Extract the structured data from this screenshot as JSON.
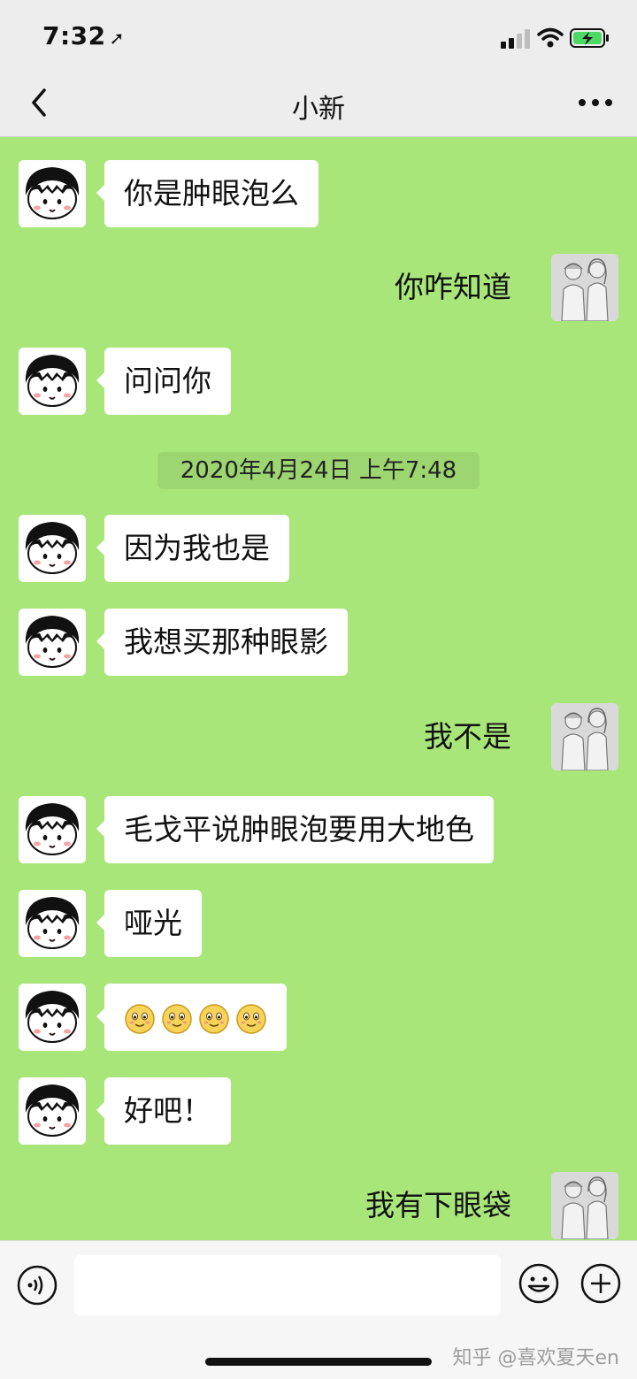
{
  "status_bar": {
    "time": "7:32",
    "battery_color": "#4cd964"
  },
  "header": {
    "title": "小新"
  },
  "messages": [
    {
      "side": "left",
      "text": "你是肿眼泡么"
    },
    {
      "side": "right",
      "text": "你咋知道"
    },
    {
      "side": "left",
      "text": "问问你"
    },
    {
      "type": "timestamp",
      "text": "2020年4月24日 上午7:48"
    },
    {
      "side": "left",
      "text": "因为我也是"
    },
    {
      "side": "left",
      "text": "我想买那种眼影"
    },
    {
      "side": "right",
      "text": "我不是"
    },
    {
      "side": "left",
      "text": "毛戈平说肿眼泡要用大地色"
    },
    {
      "side": "left",
      "text": "哑光"
    },
    {
      "side": "left",
      "emoji": [
        "smile-emoji",
        "smile-emoji",
        "smile-emoji",
        "smile-emoji"
      ]
    },
    {
      "side": "left",
      "text": "好吧！"
    },
    {
      "side": "right",
      "text": "我有下眼袋"
    }
  ],
  "input_bar": {
    "message_value": ""
  },
  "watermark": "知乎 @喜欢夏天en",
  "colors": {
    "chat_background": "#a9e67a",
    "bar_background": "#ededed",
    "bubble": "#ffffff"
  }
}
